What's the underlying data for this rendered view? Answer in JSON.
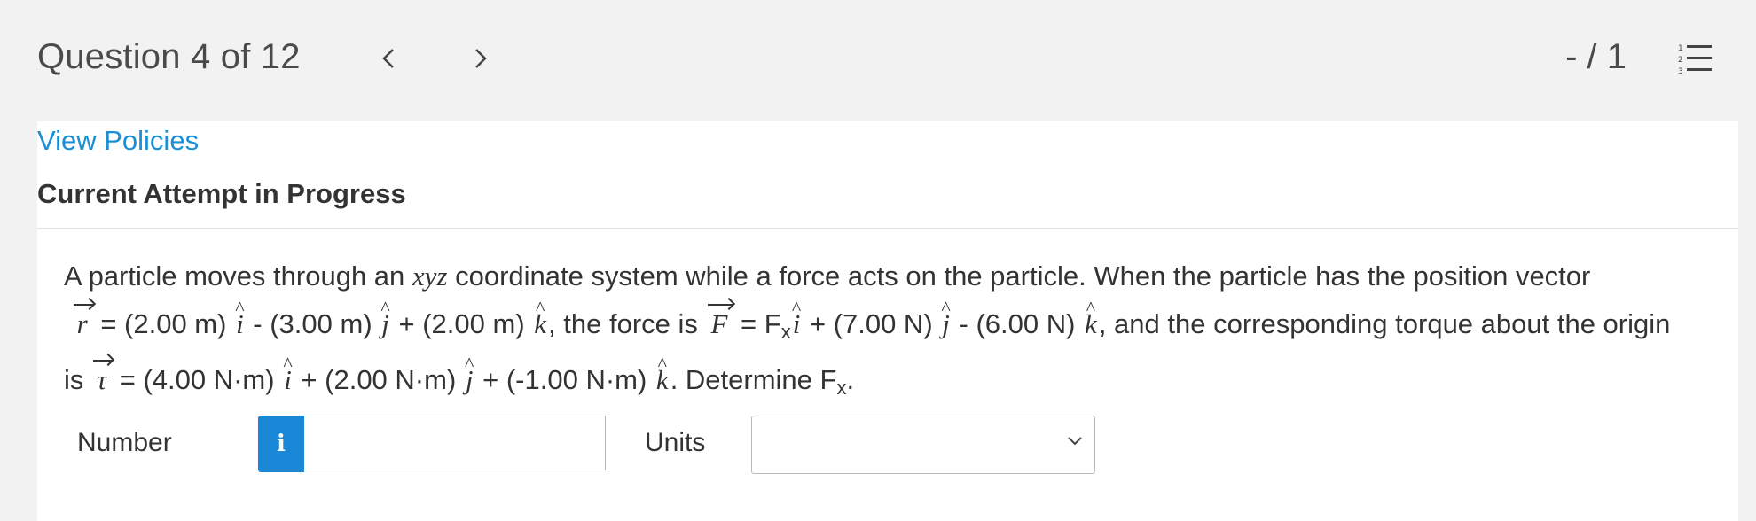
{
  "header": {
    "question_title": "Question 4 of 12",
    "score": "- / 1",
    "prev_icon": "chevron-left-icon",
    "next_icon": "chevron-right-icon",
    "list_icon": "numbered-list-icon"
  },
  "links": {
    "view_policies": "View Policies"
  },
  "status": {
    "attempt": "Current Attempt in Progress"
  },
  "question": {
    "line1_a": "A particle moves through an ",
    "line1_xyz": "xyz",
    "line1_b": " coordinate system while a force acts on the particle. When the particle has the position vector",
    "r_symbol": "r",
    "r_expr_1": " = (2.00 m) ",
    "r_expr_2": " - (3.00 m) ",
    "r_expr_3": " + (2.00 m) ",
    "force_intro": ", the force is ",
    "F_symbol": "F",
    "f_expr_1": " = F",
    "f_sub": "x",
    "f_expr_2": " + (7.00 N) ",
    "f_expr_3": " - (6.00 N) ",
    "torque_intro": ", and the corresponding torque about the origin",
    "is_word": "is ",
    "tau_symbol": "τ",
    "t_expr_1": " = (4.00 N·m) ",
    "t_expr_2": " + (2.00 N·m) ",
    "t_expr_3": " + (-1.00 N·m) ",
    "determine": ". Determine F",
    "determine_sub": "x",
    "period": ".",
    "unit_i": "i",
    "unit_j": "j",
    "unit_k": "k"
  },
  "answer": {
    "number_label": "Number",
    "info_icon_text": "i",
    "number_value": "",
    "units_label": "Units",
    "units_selected": ""
  },
  "colors": {
    "link": "#1a8fd6",
    "info_button": "#1a88d6",
    "background": "#f2f2f2"
  }
}
